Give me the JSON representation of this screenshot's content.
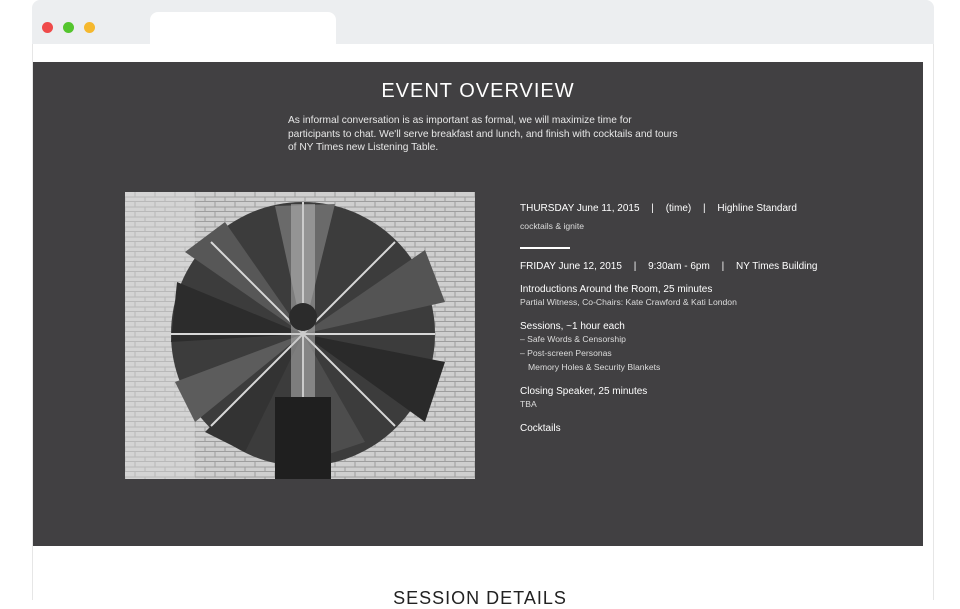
{
  "browser": {
    "dots": [
      "close",
      "minimize",
      "maximize"
    ]
  },
  "overview": {
    "title": "EVENT OVERVIEW",
    "intro": "As informal conversation is as important as formal, we will maximize time for participants to chat. We'll serve breakfast and lunch, and finish with cocktails and tours of NY Times new Listening Table.",
    "day1": {
      "day": "THURSDAY June 11, 2015",
      "time": "(time)",
      "venue": "Highline Standard",
      "note": "cocktails & ignite"
    },
    "day2": {
      "day": "FRIDAY June 12, 2015",
      "time": "9:30am - 6pm",
      "venue": "NY Times Building"
    },
    "items": {
      "intro_head": "Introductions Around the Room, 25 minutes",
      "intro_sub": "Partial Witness, Co-Chairs: Kate Crawford & Kati London",
      "sessions_head": "Sessions, ~1 hour each",
      "session1": "– Safe Words & Censorship",
      "session2": "– Post-screen Personas",
      "session3": "Memory Holes & Security Blankets",
      "closing_head": "Closing Speaker, 25 minutes",
      "closing_sub": "TBA",
      "cocktails": "Cocktails"
    }
  },
  "next_section": {
    "title": "SESSION DETAILS"
  }
}
